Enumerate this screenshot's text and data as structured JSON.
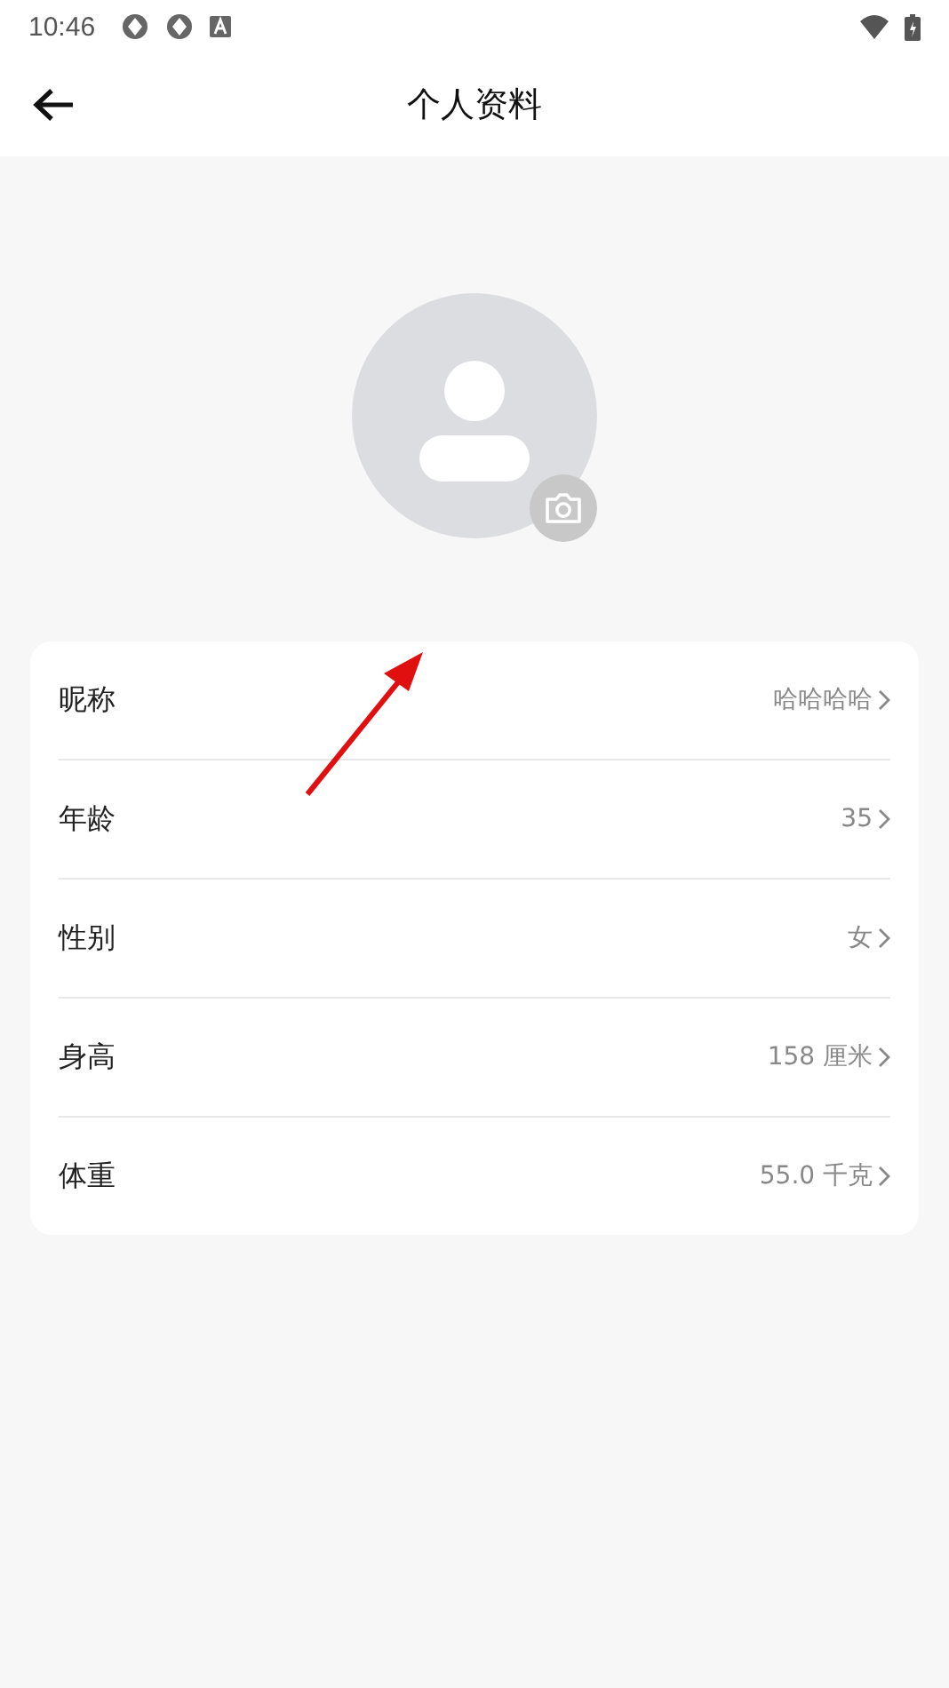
{
  "status_bar": {
    "time": "10:46"
  },
  "header": {
    "title": "个人资料"
  },
  "fields": [
    {
      "label": "昵称",
      "value": "哈哈哈哈"
    },
    {
      "label": "年龄",
      "value": "35"
    },
    {
      "label": "性别",
      "value": "女"
    },
    {
      "label": "身高",
      "value": "158 厘米"
    },
    {
      "label": "体重",
      "value": "55.0 千克"
    }
  ]
}
